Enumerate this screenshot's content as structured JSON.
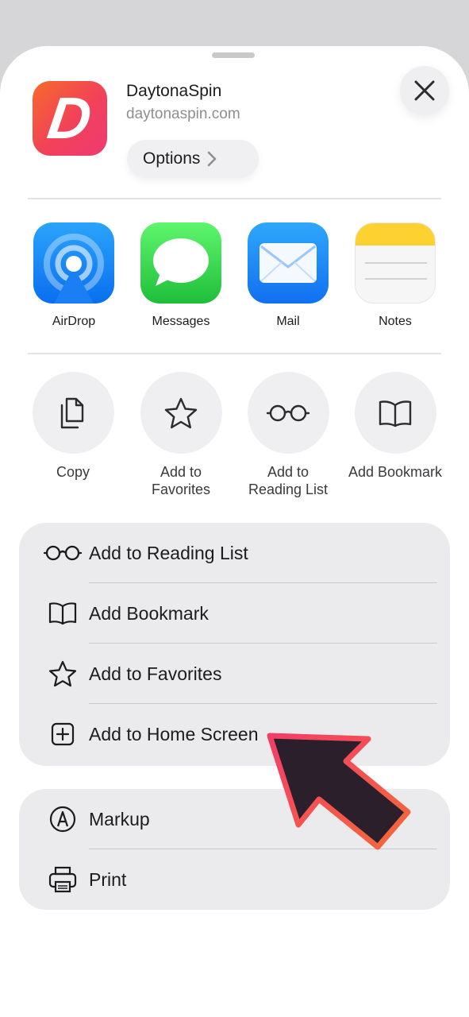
{
  "site": {
    "icon_letter": "D",
    "name": "DaytonaSpin",
    "url": "daytonaspin.com",
    "options_label": "Options"
  },
  "apps": [
    {
      "label": "AirDrop",
      "icon": "airdrop-icon"
    },
    {
      "label": "Messages",
      "icon": "messages-icon"
    },
    {
      "label": "Mail",
      "icon": "mail-icon"
    },
    {
      "label": "Notes",
      "icon": "notes-icon"
    }
  ],
  "actions": [
    {
      "label": "Copy",
      "icon": "copy-icon"
    },
    {
      "label": "Add to Favorites",
      "icon": "star-icon"
    },
    {
      "label": "Add to Reading List",
      "icon": "glasses-icon"
    },
    {
      "label": "Add Bookmark",
      "icon": "book-icon"
    }
  ],
  "menu_group_1": [
    {
      "label": "Add to Reading List",
      "icon": "glasses-icon"
    },
    {
      "label": "Add Bookmark",
      "icon": "book-icon"
    },
    {
      "label": "Add to Favorites",
      "icon": "star-icon"
    },
    {
      "label": "Add to Home Screen",
      "icon": "plus-square-icon"
    }
  ],
  "menu_group_2": [
    {
      "label": "Markup",
      "icon": "markup-icon"
    },
    {
      "label": "Print",
      "icon": "printer-icon"
    }
  ],
  "colors": {
    "sheet_bg": "#ffffff",
    "backdrop": "#d6d6d8",
    "group_bg": "#ebebed",
    "arrow_fill": "#2a1f2b",
    "arrow_stroke": "#f0405e"
  }
}
